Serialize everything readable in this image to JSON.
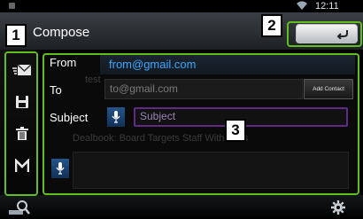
{
  "status": {
    "time": "12:11"
  },
  "screen": {
    "title": "Compose"
  },
  "callouts": {
    "sidebar": "1",
    "back": "2",
    "form": "3"
  },
  "form": {
    "from_label": "From",
    "from_value": "from@gmail.com",
    "to_label": "To",
    "to_value": "to@gmail.com",
    "add_contact_label": "Add Contact",
    "subject_label": "Subject",
    "subject_value": "Subject",
    "ghost_to": "test",
    "ghost_body": "Dealbook: Board Targets Staff With Polls"
  },
  "sidebar": {
    "items": [
      {
        "icon": "send-mail-icon"
      },
      {
        "icon": "save-icon"
      },
      {
        "icon": "delete-icon"
      },
      {
        "icon": "gmail-icon"
      }
    ]
  },
  "colors": {
    "accent_blue": "#39a7ff",
    "callout_green": "#5fc01c",
    "subject_border": "#5e2a83"
  }
}
